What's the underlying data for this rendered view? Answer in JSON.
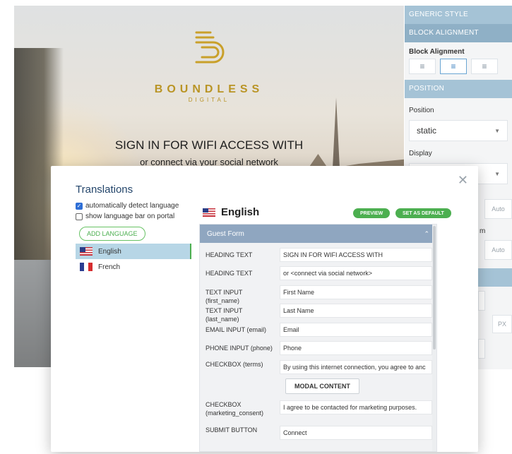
{
  "portal": {
    "brand_name": "BOUNDLESS",
    "brand_sub": "DIGITAL",
    "heading": "SIGN IN FOR WIFI ACCESS WITH",
    "subheading": "or connect via your social network"
  },
  "style_panel": {
    "generic_style": "GENERIC STYLE",
    "block_alignment_head": "BLOCK ALIGNMENT",
    "block_alignment_label": "Block Alignment",
    "position_head": "POSITION",
    "position_label": "Position",
    "position_value": "static",
    "display_label": "Display",
    "frag_auto_1": "Auto",
    "frag_auto_2": "Auto",
    "frag_m": "m",
    "frag_px": "PX"
  },
  "modal": {
    "title": "Translations",
    "auto_detect_label": "automatically detect language",
    "auto_detect_checked": true,
    "show_bar_label": "show language bar on portal",
    "show_bar_checked": false,
    "add_language": "ADD LANGUAGE",
    "languages": [
      {
        "label": "English",
        "flag": "us",
        "active": true
      },
      {
        "label": "French",
        "flag": "fr",
        "active": false
      }
    ],
    "selected_language": "English",
    "preview": "PREVIEW",
    "set_default": "SET AS DEFAULT",
    "form_section": "Guest Form",
    "rows": [
      {
        "label": "HEADING TEXT",
        "value": "SIGN IN FOR WIFI ACCESS WITH"
      },
      {
        "label": "HEADING TEXT",
        "value": "or <connect via social network>"
      },
      {
        "label": "TEXT INPUT (first_name)",
        "value": "First Name"
      },
      {
        "label": "TEXT INPUT (last_name)",
        "value": "Last Name"
      },
      {
        "label": "EMAIL INPUT (email)",
        "value": "Email"
      },
      {
        "label": "PHONE INPUT (phone)",
        "value": "Phone"
      },
      {
        "label": "CHECKBOX (terms)",
        "value": "By using this internet connection, you agree to anc"
      },
      {
        "label": "CHECKBOX (marketing_consent)",
        "value": "I agree to be contacted for marketing purposes."
      },
      {
        "label": "SUBMIT BUTTON",
        "value": "Connect"
      }
    ],
    "modal_content_button": "MODAL CONTENT"
  },
  "colors": {
    "accent_green": "#4caf50",
    "brand_gold": "#b99425",
    "header_blue": "#8fa6c0",
    "title_navy": "#24466b"
  }
}
